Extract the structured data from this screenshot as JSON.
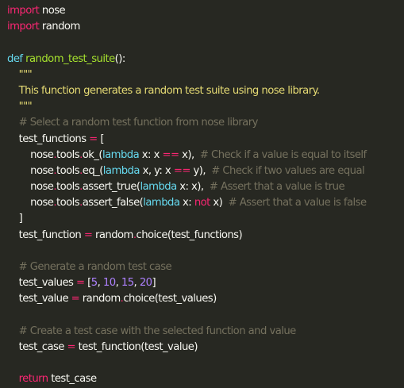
{
  "colors": {
    "background": "#272822",
    "foreground": "#f8f8f2",
    "keyword": "#f92672",
    "function": "#a6e22e",
    "string": "#e6db74",
    "comment": "#75715e",
    "number": "#ae81ff",
    "builtin": "#66d9ef"
  },
  "code": {
    "lines": [
      [
        {
          "t": "kw",
          "v": "import"
        },
        {
          "t": "pl",
          "v": " nose"
        }
      ],
      [
        {
          "t": "kw",
          "v": "import"
        },
        {
          "t": "pl",
          "v": " random"
        }
      ],
      [],
      [
        {
          "t": "blt",
          "v": "def"
        },
        {
          "t": "pl",
          "v": " "
        },
        {
          "t": "fn",
          "v": "random_test_suite"
        },
        {
          "t": "pl",
          "v": "():"
        }
      ],
      [
        {
          "t": "str",
          "v": "    \"\"\""
        }
      ],
      [
        {
          "t": "str",
          "v": "    This function generates a random test suite using nose library."
        }
      ],
      [
        {
          "t": "str",
          "v": "    \"\"\""
        }
      ],
      [
        {
          "t": "cm",
          "v": "    # Select a random test function from nose library"
        }
      ],
      [
        {
          "t": "pl",
          "v": "    test_functions "
        },
        {
          "t": "kw",
          "v": "="
        },
        {
          "t": "pl",
          "v": " ["
        }
      ],
      [
        {
          "t": "pl",
          "v": "        nose"
        },
        {
          "t": "kw",
          "v": "."
        },
        {
          "t": "pl",
          "v": "tools"
        },
        {
          "t": "kw",
          "v": "."
        },
        {
          "t": "pl",
          "v": "ok_("
        },
        {
          "t": "blt",
          "v": "lambda"
        },
        {
          "t": "pl",
          "v": " x: x "
        },
        {
          "t": "kw",
          "v": "=="
        },
        {
          "t": "pl",
          "v": " x),  "
        },
        {
          "t": "cm",
          "v": "# Check if a value is equal to itself"
        }
      ],
      [
        {
          "t": "pl",
          "v": "        nose"
        },
        {
          "t": "kw",
          "v": "."
        },
        {
          "t": "pl",
          "v": "tools"
        },
        {
          "t": "kw",
          "v": "."
        },
        {
          "t": "pl",
          "v": "eq_("
        },
        {
          "t": "blt",
          "v": "lambda"
        },
        {
          "t": "pl",
          "v": " x, y: x "
        },
        {
          "t": "kw",
          "v": "=="
        },
        {
          "t": "pl",
          "v": " y),  "
        },
        {
          "t": "cm",
          "v": "# Check if two values are equal"
        }
      ],
      [
        {
          "t": "pl",
          "v": "        nose"
        },
        {
          "t": "kw",
          "v": "."
        },
        {
          "t": "pl",
          "v": "tools"
        },
        {
          "t": "kw",
          "v": "."
        },
        {
          "t": "pl",
          "v": "assert_true("
        },
        {
          "t": "blt",
          "v": "lambda"
        },
        {
          "t": "pl",
          "v": " x: x),  "
        },
        {
          "t": "cm",
          "v": "# Assert that a value is true"
        }
      ],
      [
        {
          "t": "pl",
          "v": "        nose"
        },
        {
          "t": "kw",
          "v": "."
        },
        {
          "t": "pl",
          "v": "tools"
        },
        {
          "t": "kw",
          "v": "."
        },
        {
          "t": "pl",
          "v": "assert_false("
        },
        {
          "t": "blt",
          "v": "lambda"
        },
        {
          "t": "pl",
          "v": " x: "
        },
        {
          "t": "kw",
          "v": "not"
        },
        {
          "t": "pl",
          "v": " x)  "
        },
        {
          "t": "cm",
          "v": "# Assert that a value is false"
        }
      ],
      [
        {
          "t": "pl",
          "v": "    ]"
        }
      ],
      [
        {
          "t": "pl",
          "v": "    test_function "
        },
        {
          "t": "kw",
          "v": "="
        },
        {
          "t": "pl",
          "v": " random"
        },
        {
          "t": "kw",
          "v": "."
        },
        {
          "t": "pl",
          "v": "choice(test_functions)"
        }
      ],
      [],
      [
        {
          "t": "cm",
          "v": "    # Generate a random test case"
        }
      ],
      [
        {
          "t": "pl",
          "v": "    test_values "
        },
        {
          "t": "kw",
          "v": "="
        },
        {
          "t": "pl",
          "v": " ["
        },
        {
          "t": "num",
          "v": "5"
        },
        {
          "t": "pl",
          "v": ", "
        },
        {
          "t": "num",
          "v": "10"
        },
        {
          "t": "pl",
          "v": ", "
        },
        {
          "t": "num",
          "v": "15"
        },
        {
          "t": "pl",
          "v": ", "
        },
        {
          "t": "num",
          "v": "20"
        },
        {
          "t": "pl",
          "v": "]"
        }
      ],
      [
        {
          "t": "pl",
          "v": "    test_value "
        },
        {
          "t": "kw",
          "v": "="
        },
        {
          "t": "pl",
          "v": " random"
        },
        {
          "t": "kw",
          "v": "."
        },
        {
          "t": "pl",
          "v": "choice(test_values)"
        }
      ],
      [],
      [
        {
          "t": "cm",
          "v": "    # Create a test case with the selected function and value"
        }
      ],
      [
        {
          "t": "pl",
          "v": "    test_case "
        },
        {
          "t": "kw",
          "v": "="
        },
        {
          "t": "pl",
          "v": " test_function(test_value)"
        }
      ],
      [],
      [
        {
          "t": "kw",
          "v": "    return"
        },
        {
          "t": "pl",
          "v": " test_case"
        }
      ]
    ]
  }
}
